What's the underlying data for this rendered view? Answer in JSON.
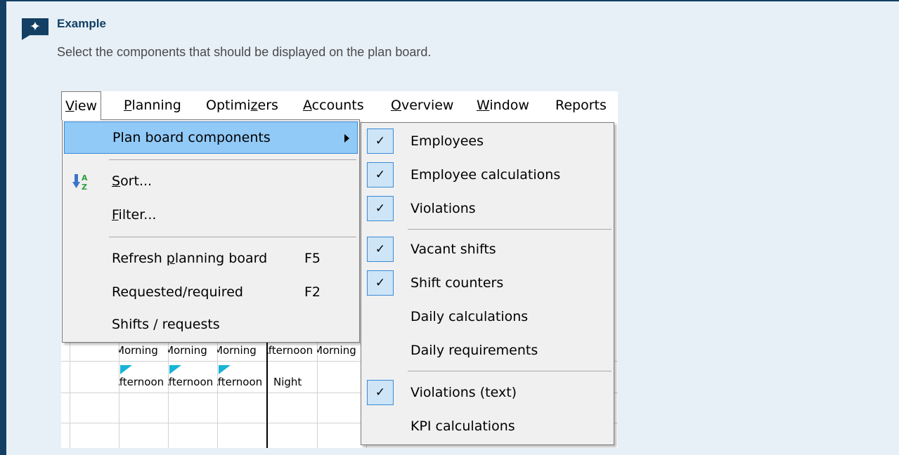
{
  "callout": {
    "title": "Example",
    "text": "Select the components that should be displayed on the plan board.",
    "icon": "sparkle-icon"
  },
  "menubar": [
    {
      "label": "View",
      "mnemonic": "V",
      "rest": "iew"
    },
    {
      "label": "Planning",
      "mnemonic": "P",
      "rest": "lanning"
    },
    {
      "label": "Optimizers",
      "pre": "Optimi",
      "mnemonic": "z",
      "rest": "ers"
    },
    {
      "label": "Accounts",
      "mnemonic": "A",
      "rest": "ccounts"
    },
    {
      "label": "Overview",
      "mnemonic": "O",
      "rest": "verview"
    },
    {
      "label": "Window",
      "mnemonic": "W",
      "rest": "indow"
    },
    {
      "label": "Reports",
      "mnemonic": "",
      "rest": "Reports"
    }
  ],
  "view_menu": {
    "plan_board_components": "Plan board components",
    "sort_mn": "S",
    "sort_rest": "ort...",
    "filter_mn": "F",
    "filter_rest": "ilter...",
    "refresh_pre": "Refresh ",
    "refresh_mn": "p",
    "refresh_rest": "lanning board",
    "refresh_shortcut": "F5",
    "requested": "Requested/required",
    "requested_shortcut": "F2",
    "shifts": "Shifts / requests"
  },
  "submenu": [
    {
      "label": "Employees",
      "checked": true
    },
    {
      "label": "Employee calculations",
      "checked": true
    },
    {
      "label": "Violations",
      "checked": true
    },
    {
      "label": "Vacant shifts",
      "checked": true
    },
    {
      "label": "Shift counters",
      "checked": true
    },
    {
      "label": "Daily calculations",
      "checked": false
    },
    {
      "label": "Daily requirements",
      "checked": false
    },
    {
      "label": "Violations (text)",
      "checked": true
    },
    {
      "label": "KPI calculations",
      "checked": false
    }
  ],
  "checkmark": "✓",
  "grid": {
    "row1": [
      "Morning",
      "Morning",
      "Morning",
      "Afternoon",
      "Morning"
    ],
    "row2": [
      "Afternoon",
      "Afternoon",
      "Afternoon",
      "Night"
    ]
  },
  "colors": {
    "accent": "#123f63",
    "callout_bg": "#e7f0f7",
    "highlight": "#91c9f7",
    "check_bg": "#cde5f7",
    "flag": "#18b4d8"
  }
}
